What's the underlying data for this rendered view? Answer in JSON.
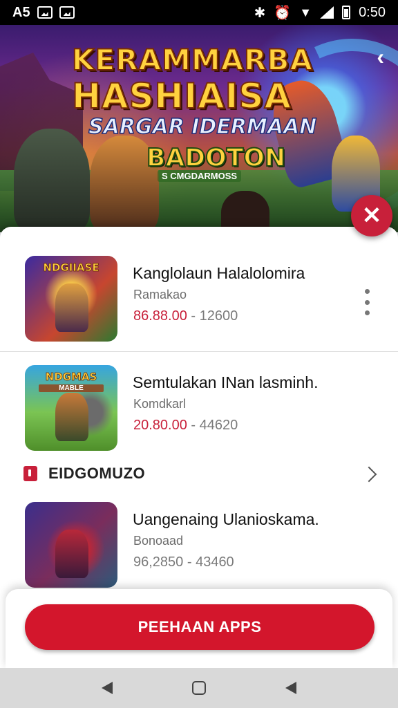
{
  "status_bar": {
    "left_text": "A5",
    "time": "0:50"
  },
  "hero": {
    "title_line1": "KERAMMARBA",
    "title_line2": "HASHIAISA",
    "subtitle": "SARGAR IDERMAAN",
    "badge_title": "BADOTON",
    "badge_subtitle": "S CMGDARMOSS",
    "back_glyph": "‹"
  },
  "close_button": {
    "glyph": "✕"
  },
  "apps": [
    {
      "thumb_label": "NDGIIASE",
      "thumb_sub": "",
      "title": "Kanglolaun Halalolomira",
      "developer": "Ramakao",
      "price_main": "86.88.00",
      "price_rest": " - 12600"
    },
    {
      "thumb_label": "NDGMAS",
      "thumb_sub": "MABLE",
      "title": "Semtulakan INan lasminh.",
      "developer": "Komdkarl",
      "price_main": "20.80.00",
      "price_rest": " - 44620"
    },
    {
      "thumb_label": "",
      "thumb_sub": "",
      "title": "Uangenaing Ulanioskama.",
      "developer": "Bonoaad",
      "price_main": "",
      "price_rest": "96,2850 - 43460"
    }
  ],
  "section": {
    "title": "EIDGOMUZO"
  },
  "cta": {
    "label": "PEEHAAN APPS"
  },
  "colors": {
    "accent": "#c8203a",
    "cta": "#d3162c"
  }
}
